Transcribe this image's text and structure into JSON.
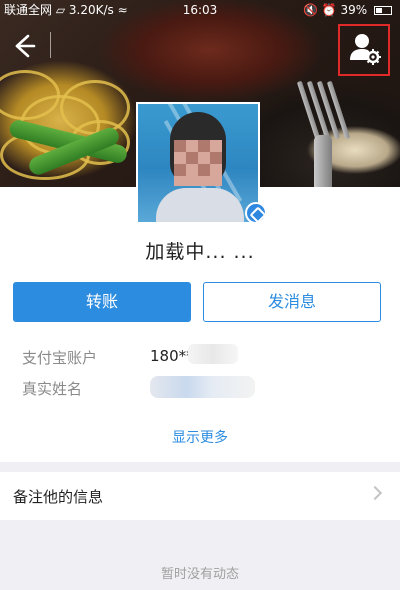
{
  "status_bar": {
    "carrier": "联通全网",
    "speed": "3.20K/s",
    "time": "16:03",
    "battery": "39%"
  },
  "nav": {
    "back_icon": "back-arrow-icon",
    "settings_icon": "user-settings-icon"
  },
  "profile": {
    "name": "加载中... ...",
    "verified_icon": "verified-badge-icon"
  },
  "actions": {
    "transfer_label": "转账",
    "message_label": "发消息"
  },
  "info": {
    "account_label": "支付宝账户",
    "account_value": "180**",
    "realname_label": "真实姓名",
    "show_more": "显示更多"
  },
  "remark": {
    "label": "备注他的信息"
  },
  "feed": {
    "empty_text": "暂时没有动态"
  },
  "colors": {
    "accent": "#2c8ce0",
    "highlight_box": "#e02a2a"
  }
}
